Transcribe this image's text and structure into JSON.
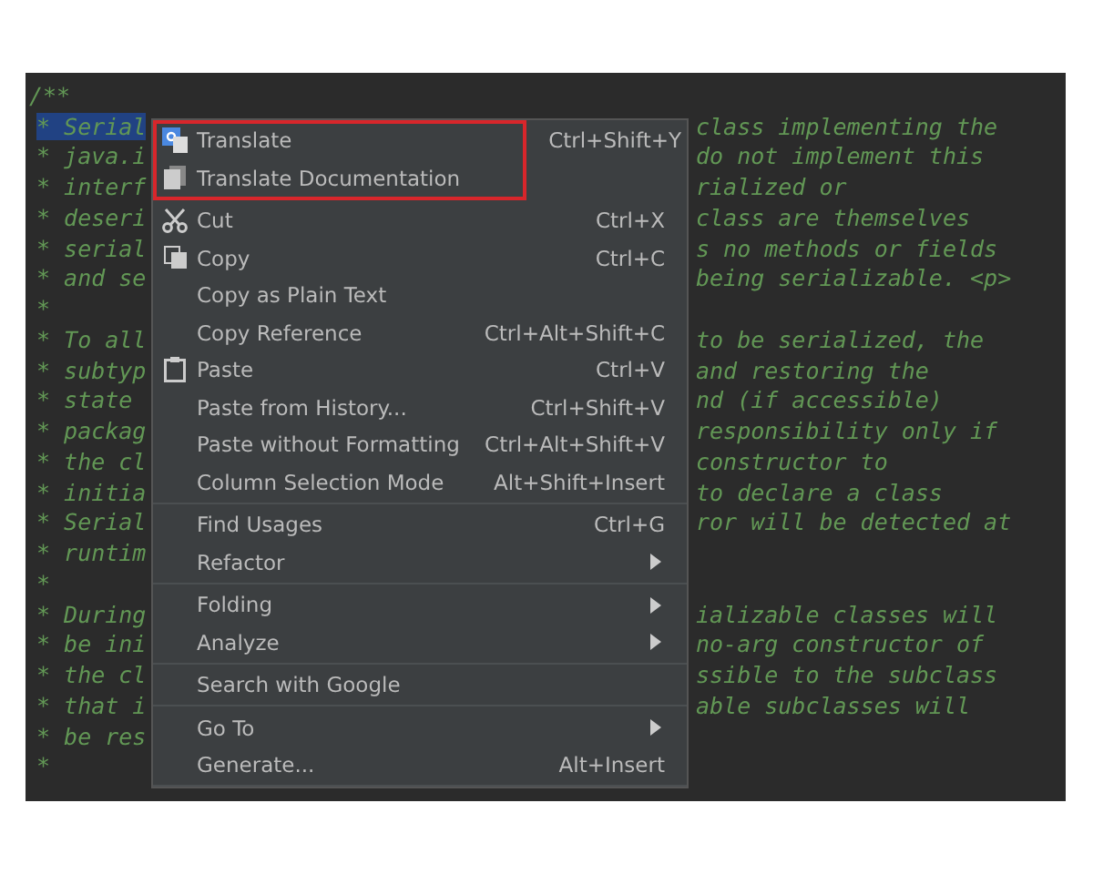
{
  "editor": {
    "first_line": "/**",
    "lines": [
      {
        "left": "* Serial",
        "right": "class implementing the",
        "selected": true
      },
      {
        "left": "* java.i",
        "right": "do not implement this",
        "selected": false
      },
      {
        "left": "* interf",
        "right": "rialized or",
        "selected": false
      },
      {
        "left": "* deseri",
        "right": "class are themselves",
        "selected": false
      },
      {
        "left": "* serial",
        "right": "s no methods or fields",
        "selected": false
      },
      {
        "left": "* and se",
        "right": "being serializable. <p>",
        "selected": false
      },
      {
        "left": "*",
        "selected": false
      },
      {
        "left": "* To all",
        "right": "to be serialized, the",
        "selected": false
      },
      {
        "left": "* subtyp",
        "right": "and restoring the",
        "selected": false
      },
      {
        "left": "* state",
        "right": "nd (if accessible)",
        "selected": false
      },
      {
        "left": "* packag",
        "right": "responsibility only if",
        "selected": false
      },
      {
        "left": "* the cl",
        "right": "constructor to",
        "selected": false
      },
      {
        "left": "* initia",
        "right": "to declare a class",
        "selected": false
      },
      {
        "left": "* Serial",
        "right": "ror will be detected at",
        "selected": false
      },
      {
        "left": "* runtim",
        "selected": false
      },
      {
        "left": "*",
        "selected": false
      },
      {
        "left": "* During",
        "right": "ializable classes will",
        "selected": false
      },
      {
        "left": "* be ini",
        "right": "no-arg constructor of",
        "selected": false
      },
      {
        "left": "* the cl",
        "right": "ssible to the subclass",
        "selected": false
      },
      {
        "left": "* that i",
        "right": "able subclasses will",
        "selected": false
      },
      {
        "left": "* be res",
        "selected": false
      },
      {
        "left": "*",
        "selected": false
      }
    ]
  },
  "context_menu": {
    "groups": [
      {
        "highlighted": true,
        "items": [
          {
            "label": "Translate",
            "shortcut": "Ctrl+Shift+Y",
            "kind": "translate",
            "submenu": false
          },
          {
            "label": "Translate Documentation",
            "kind": "document",
            "submenu": false
          }
        ]
      },
      {
        "highlighted": false,
        "items": [
          {
            "label": "Cut",
            "shortcut": "Ctrl+X",
            "kind": "cut",
            "submenu": false
          },
          {
            "label": "Copy",
            "shortcut": "Ctrl+C",
            "kind": "copy",
            "submenu": false
          },
          {
            "label": "Copy as Plain Text",
            "kind": "plain",
            "submenu": false
          },
          {
            "label": "Copy Reference",
            "shortcut": "Ctrl+Alt+Shift+C",
            "kind": "plain",
            "submenu": false
          },
          {
            "label": "Paste",
            "shortcut": "Ctrl+V",
            "kind": "paste",
            "submenu": false
          },
          {
            "label": "Paste from History...",
            "shortcut": "Ctrl+Shift+V",
            "kind": "plain",
            "submenu": false
          },
          {
            "label": "Paste without Formatting",
            "shortcut": "Ctrl+Alt+Shift+V",
            "kind": "plain",
            "submenu": false
          },
          {
            "label": "Column Selection Mode",
            "shortcut": "Alt+Shift+Insert",
            "kind": "plain",
            "submenu": false
          }
        ]
      },
      {
        "highlighted": false,
        "items": [
          {
            "label": "Find Usages",
            "shortcut": "Ctrl+G",
            "kind": "plain",
            "submenu": false
          },
          {
            "label": "Refactor",
            "kind": "plain",
            "submenu": true
          }
        ]
      },
      {
        "highlighted": false,
        "items": [
          {
            "label": "Folding",
            "kind": "plain",
            "submenu": true
          },
          {
            "label": "Analyze",
            "kind": "plain",
            "submenu": true
          }
        ]
      },
      {
        "highlighted": false,
        "items": [
          {
            "label": "Search with Google",
            "kind": "plain",
            "submenu": false
          }
        ]
      },
      {
        "highlighted": false,
        "items": [
          {
            "label": "Go To",
            "kind": "plain",
            "submenu": true
          },
          {
            "label": "Generate...",
            "shortcut": "Alt+Insert",
            "kind": "plain",
            "submenu": false
          }
        ]
      }
    ]
  }
}
